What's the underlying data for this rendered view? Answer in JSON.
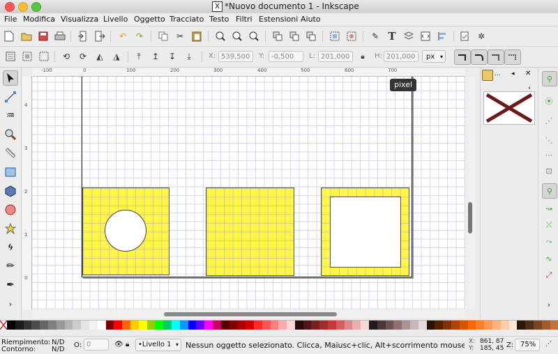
{
  "window": {
    "title": "*Nuovo documento 1 - Inkscape",
    "app_badge": "X"
  },
  "menu": [
    "File",
    "Modifica",
    "Visualizza",
    "Livello",
    "Oggetto",
    "Tracciato",
    "Testo",
    "Filtri",
    "Estensioni",
    "Aiuto"
  ],
  "select_toolbar": {
    "x_label": "X:",
    "x_value": "539,500",
    "y_label": "Y:",
    "y_value": "-0,500",
    "w_label": "L:",
    "w_value": "201,000",
    "h_label": "H:",
    "h_value": "201,000",
    "unit": "px"
  },
  "ruler": {
    "h_ticks": [
      "-100",
      "0",
      "100",
      "200",
      "300",
      "400",
      "500",
      "600",
      "700"
    ],
    "v_ticks": [
      "4",
      "3",
      "2",
      "1",
      "0",
      "1",
      "2"
    ]
  },
  "tooltip": "pixel",
  "status": {
    "fill_label": "Riempimento:",
    "fill_value": "N/D",
    "stroke_label": "Contorno:",
    "stroke_value": "N/D",
    "opacity_label": "O:",
    "opacity_value": "0",
    "layer": "•Livello 1",
    "message": "Nessun oggetto selezionato. Clicca, Maiusc+clic, Alt+scorrimento mouse sugli og...",
    "x_coord": "861, 87",
    "y_coord": "185, 45",
    "zoom_label": "Z:",
    "zoom": "75%"
  },
  "colors": {
    "accent_fill": "#fff22a",
    "swatch_none": "#ffffff"
  },
  "palette": [
    "#000000",
    "#1a1a1a",
    "#333333",
    "#4d4d4d",
    "#666666",
    "#808080",
    "#999999",
    "#b3b3b3",
    "#cccccc",
    "#e6e6e6",
    "#f2f2f2",
    "#ffffff",
    "#800000",
    "#ff0000",
    "#ff6600",
    "#ffcc00",
    "#ffff00",
    "#99cc00",
    "#00ff00",
    "#00cc66",
    "#00ffff",
    "#0099ff",
    "#0000ff",
    "#6600ff",
    "#ff00ff",
    "#cc0066",
    "#550000",
    "#800000",
    "#aa0000",
    "#d40000",
    "#ff2a2a",
    "#ff5555",
    "#ff8080",
    "#ffaaaa",
    "#ffd5d5",
    "#280b0b",
    "#501616",
    "#782121",
    "#a02c2c",
    "#c83737",
    "#d35f5f",
    "#de8787",
    "#e9afaf",
    "#f4d7d7",
    "#241c1c",
    "#483737",
    "#6c5353",
    "#916f6f",
    "#ac9393",
    "#c8b7b7",
    "#e3dbdb",
    "#2b1100",
    "#552200",
    "#803300",
    "#aa4400",
    "#d45500",
    "#ff6600",
    "#ff7f2a",
    "#ff9955",
    "#ffb380",
    "#ffccaa",
    "#ffe6d5",
    "#28170b",
    "#502d16",
    "#784421",
    "#a05a2c",
    "#c87137"
  ]
}
